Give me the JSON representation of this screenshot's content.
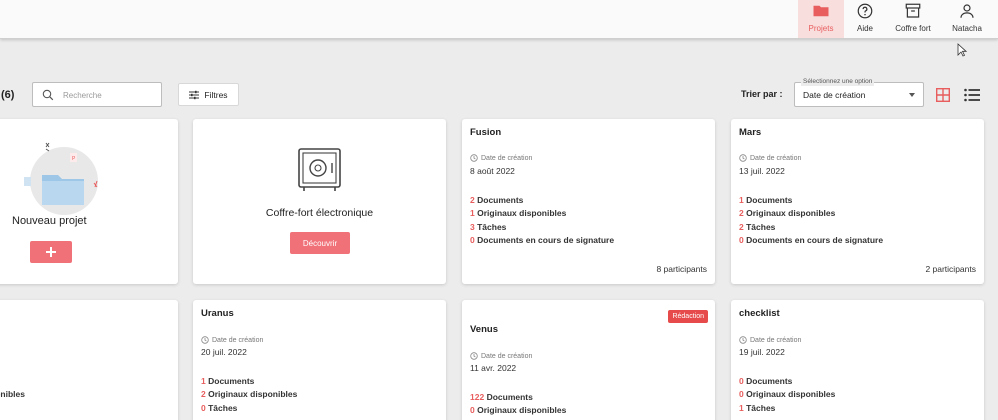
{
  "nav": {
    "projets": "Projets",
    "aide": "Aide",
    "coffre": "Coffre fort",
    "user": "Natacha"
  },
  "toolbar": {
    "count": "(6)",
    "search_placeholder": "Recherche",
    "filters": "Filtres",
    "sort_label": "Trier par :",
    "sort_legend": "Sélectionnez une option",
    "sort_value": "Date de création"
  },
  "colors": {
    "accent": "#e85d5d",
    "button": "#f07178",
    "badge": "#e64a4a"
  },
  "new_project": {
    "title": "Nouveau projet"
  },
  "safe": {
    "title": "Coffre-fort électronique",
    "button": "Découvrir"
  },
  "date_label": "Date de création",
  "projects": [
    {
      "name": "Fusion",
      "date": "8 août 2022",
      "stats": [
        {
          "n": "2",
          "label": "Documents"
        },
        {
          "n": "1",
          "label": "Originaux disponibles"
        },
        {
          "n": "3",
          "label": "Tâches"
        },
        {
          "n": "0",
          "label": "Documents en cours de signature"
        }
      ],
      "participants": "8 participants"
    },
    {
      "name": "Mars",
      "date": "13 juil. 2022",
      "stats": [
        {
          "n": "1",
          "label": "Documents"
        },
        {
          "n": "2",
          "label": "Originaux disponibles"
        },
        {
          "n": "2",
          "label": "Tâches"
        },
        {
          "n": "0",
          "label": "Documents en cours de signature"
        }
      ],
      "participants": "2 participants"
    },
    {
      "name": "Uranus",
      "date": "20 juil. 2022",
      "stats": [
        {
          "n": "1",
          "label": "Documents"
        },
        {
          "n": "2",
          "label": "Originaux disponibles"
        },
        {
          "n": "0",
          "label": "Tâches"
        }
      ]
    },
    {
      "name": "Venus",
      "date": "11 avr. 2022",
      "badge": "Rédaction",
      "stats": [
        {
          "n": "122",
          "label": "Documents"
        },
        {
          "n": "0",
          "label": "Originaux disponibles"
        }
      ]
    },
    {
      "name": "checklist",
      "date": "19 juil. 2022",
      "stats": [
        {
          "n": "0",
          "label": "Documents"
        },
        {
          "n": "0",
          "label": "Originaux disponibles"
        },
        {
          "n": "1",
          "label": "Tâches"
        }
      ]
    }
  ],
  "partial_card": {
    "fragment": "ponibles"
  }
}
